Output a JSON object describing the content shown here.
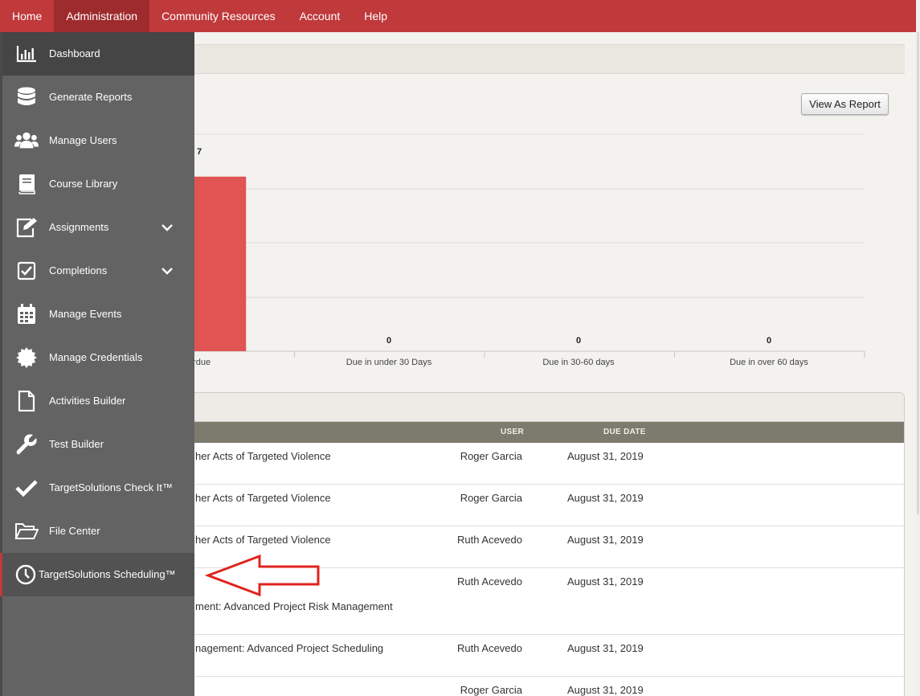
{
  "topnav": {
    "items": [
      "Home",
      "Administration",
      "Community Resources",
      "Account",
      "Help"
    ],
    "active": "Administration"
  },
  "toolbar": {
    "view_report_label": "View As Report"
  },
  "chart_data": {
    "type": "bar",
    "categories": [
      "Overdue",
      "Due in under 30 Days",
      "Due in 30-60 days",
      "Due in over 60 days"
    ],
    "values": [
      7,
      0,
      0,
      0
    ],
    "color": "#e05454",
    "grid": true
  },
  "chart_labels": {
    "bar0_value_visible": "7",
    "bar0_label_visible": "erdue",
    "bar1_value": "0",
    "bar2_value": "0",
    "bar3_value": "0"
  },
  "table": {
    "columns": {
      "user": "USER",
      "due": "DUE DATE"
    },
    "rows": [
      {
        "course": "her Acts of Targeted Violence",
        "course2": "",
        "user": "Roger Garcia",
        "due": "August 31, 2019"
      },
      {
        "course": "her Acts of Targeted Violence",
        "course2": "",
        "user": "Roger Garcia",
        "due": "August 31, 2019"
      },
      {
        "course": "her Acts of Targeted Violence",
        "course2": "",
        "user": "Ruth Acevedo",
        "due": "August 31, 2019"
      },
      {
        "course": "",
        "course2": "ment: Advanced Project Risk Management",
        "user": "Ruth Acevedo",
        "due": "August 31, 2019"
      },
      {
        "course": "nagement: Advanced Project Scheduling",
        "course2": "",
        "user": "Ruth Acevedo",
        "due": "August 31, 2019"
      },
      {
        "course": "",
        "course2": "",
        "user": "Roger Garcia",
        "due": "August 31, 2019"
      }
    ]
  },
  "sidebar": {
    "items": [
      {
        "label": "Dashboard",
        "icon": "bar-chart-icon"
      },
      {
        "label": "Generate Reports",
        "icon": "database-icon"
      },
      {
        "label": "Manage Users",
        "icon": "users-icon"
      },
      {
        "label": "Course Library",
        "icon": "book-icon"
      },
      {
        "label": "Assignments",
        "icon": "edit-icon"
      },
      {
        "label": "Completions",
        "icon": "checkbox-icon"
      },
      {
        "label": "Manage Events",
        "icon": "calendar-icon"
      },
      {
        "label": "Manage Credentials",
        "icon": "badge-icon"
      },
      {
        "label": "Activities Builder",
        "icon": "file-icon"
      },
      {
        "label": "Test Builder",
        "icon": "wrench-icon"
      },
      {
        "label": "TargetSolutions Check It™",
        "icon": "checkmark-icon"
      },
      {
        "label": "File Center",
        "icon": "folder-icon"
      },
      {
        "label": "TargetSolutions Scheduling™",
        "icon": "clock-icon"
      }
    ]
  },
  "colors": {
    "nav": "#c0393b",
    "sidebar": "#636363",
    "bar": "#e05454",
    "arrow": "#e0231e"
  }
}
